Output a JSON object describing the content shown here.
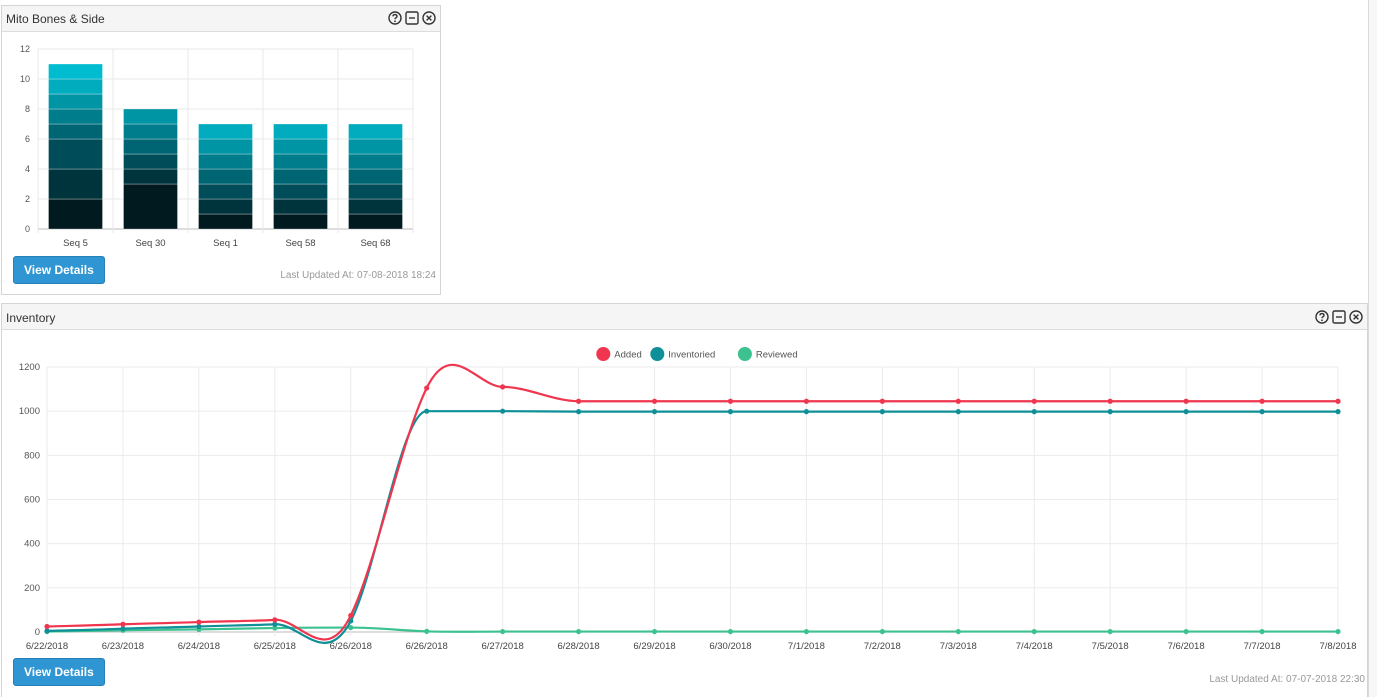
{
  "bar_widget": {
    "title": "Mito Bones & Side",
    "button_label": "View Details",
    "last_updated": "Last Updated At: 07-08-2018 18:24"
  },
  "line_widget": {
    "title": "Inventory",
    "button_label": "View Details",
    "last_updated": "Last Updated At: 07-07-2018 22:30"
  },
  "colors": {
    "stack": [
      "#001a1f",
      "#00343d",
      "#004d59",
      "#006573",
      "#007d8c",
      "#0095a5",
      "#00acbd",
      "#00bcd0",
      "#26c4d6",
      "#55cfde",
      "#8ed9e6"
    ]
  },
  "chart_data": [
    {
      "type": "bar",
      "stacked": true,
      "categories": [
        "Seq 5",
        "Seq 30",
        "Seq 1",
        "Seq 58",
        "Seq 68"
      ],
      "segments": [
        [
          2,
          2,
          2,
          1,
          1,
          1,
          1,
          1
        ],
        [
          3,
          1,
          1,
          1,
          1,
          1
        ],
        [
          1,
          1,
          1,
          1,
          1,
          1,
          1
        ],
        [
          1,
          1,
          1,
          1,
          1,
          1,
          1
        ],
        [
          1,
          1,
          1,
          1,
          1,
          1,
          1
        ]
      ],
      "ylim": [
        0,
        12
      ],
      "yticks": [
        0,
        2,
        4,
        6,
        8,
        10,
        12
      ],
      "grid": true
    },
    {
      "type": "line",
      "x": [
        "6/22/2018",
        "6/23/2018",
        "6/24/2018",
        "6/25/2018",
        "6/26/2018",
        "6/26/2018",
        "6/27/2018",
        "6/28/2018",
        "6/29/2018",
        "6/30/2018",
        "7/1/2018",
        "7/2/2018",
        "7/3/2018",
        "7/4/2018",
        "7/5/2018",
        "7/6/2018",
        "7/7/2018",
        "7/8/2018"
      ],
      "series": [
        {
          "name": "Added",
          "color": "#f0364f",
          "values": [
            25,
            35,
            45,
            55,
            75,
            1105,
            1110,
            1045,
            1045,
            1045,
            1045,
            1045,
            1045,
            1045,
            1045,
            1045,
            1045,
            1045
          ]
        },
        {
          "name": "Inventoried",
          "color": "#0f8f97",
          "values": [
            5,
            15,
            25,
            35,
            50,
            1000,
            1000,
            998,
            998,
            998,
            998,
            998,
            998,
            998,
            998,
            998,
            998,
            998
          ]
        },
        {
          "name": "Reviewed",
          "color": "#3cc190",
          "values": [
            2,
            8,
            12,
            18,
            20,
            3,
            2,
            2,
            2,
            2,
            2,
            2,
            2,
            2,
            2,
            2,
            2,
            2
          ]
        }
      ],
      "ylim": [
        0,
        1200
      ],
      "yticks": [
        0,
        200,
        400,
        600,
        800,
        1000,
        1200
      ],
      "grid": true,
      "legend": "top-center"
    }
  ]
}
